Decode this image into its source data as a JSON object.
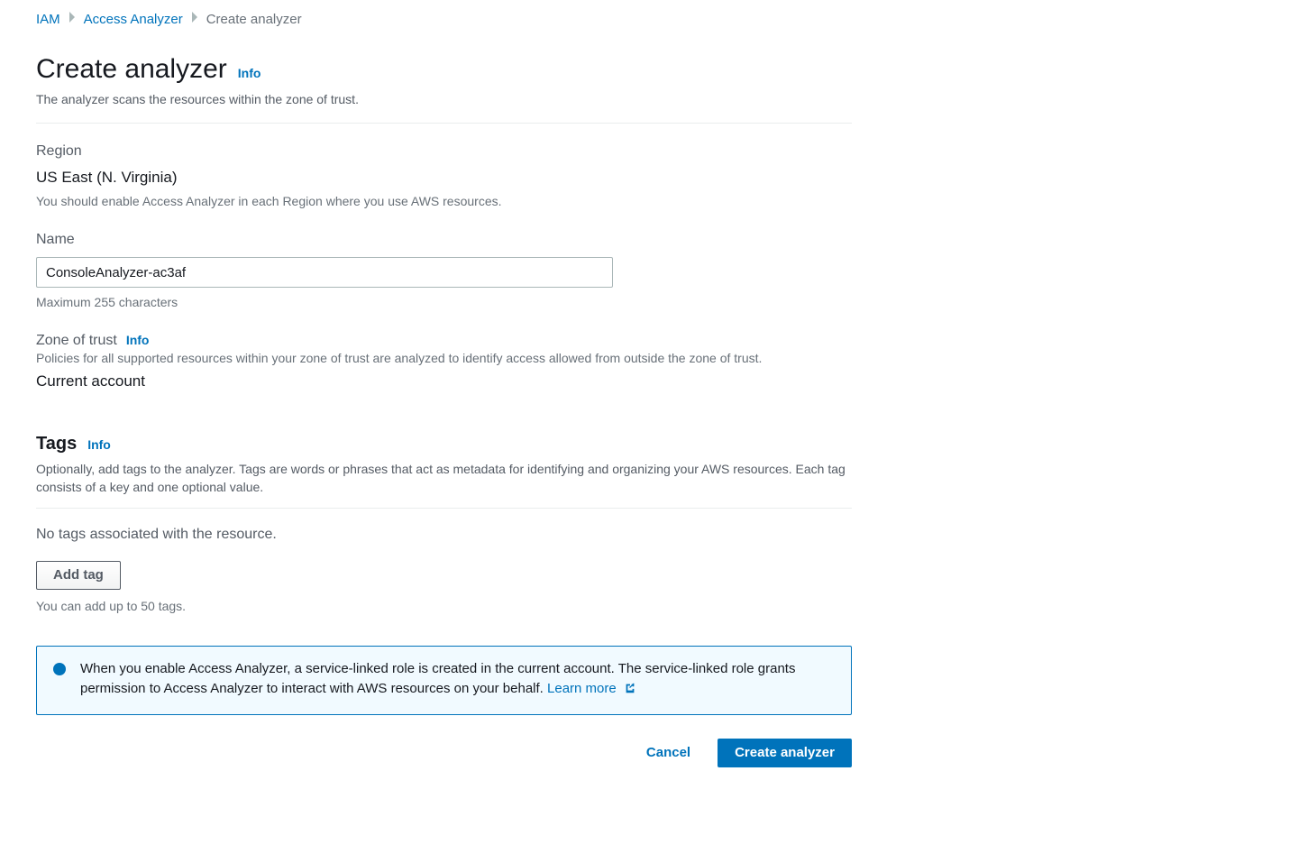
{
  "breadcrumb": {
    "items": [
      {
        "label": "IAM",
        "type": "link"
      },
      {
        "label": "Access Analyzer",
        "type": "link"
      },
      {
        "label": "Create analyzer",
        "type": "current"
      }
    ]
  },
  "header": {
    "title": "Create analyzer",
    "info_label": "Info",
    "subtitle": "The analyzer scans the resources within the zone of trust."
  },
  "region": {
    "label": "Region",
    "value": "US East (N. Virginia)",
    "help": "You should enable Access Analyzer in each Region where you use AWS resources."
  },
  "name": {
    "label": "Name",
    "value": "ConsoleAnalyzer-ac3af",
    "help": "Maximum 255 characters"
  },
  "zone": {
    "label": "Zone of trust",
    "info_label": "Info",
    "help": "Policies for all supported resources within your zone of trust are analyzed to identify access allowed from outside the zone of trust.",
    "value": "Current account"
  },
  "tags": {
    "title": "Tags",
    "info_label": "Info",
    "description": "Optionally, add tags to the analyzer. Tags are words or phrases that act as metadata for identifying and organizing your AWS resources. Each tag consists of a key and one optional value.",
    "empty_message": "No tags associated with the resource.",
    "add_button": "Add tag",
    "limit_help": "You can add up to 50 tags."
  },
  "alert": {
    "text": "When you enable Access Analyzer, a service-linked role is created in the current account. The service-linked role grants permission to Access Analyzer to interact with AWS resources on your behalf. ",
    "learn_more": "Learn more"
  },
  "actions": {
    "cancel": "Cancel",
    "create": "Create analyzer"
  }
}
